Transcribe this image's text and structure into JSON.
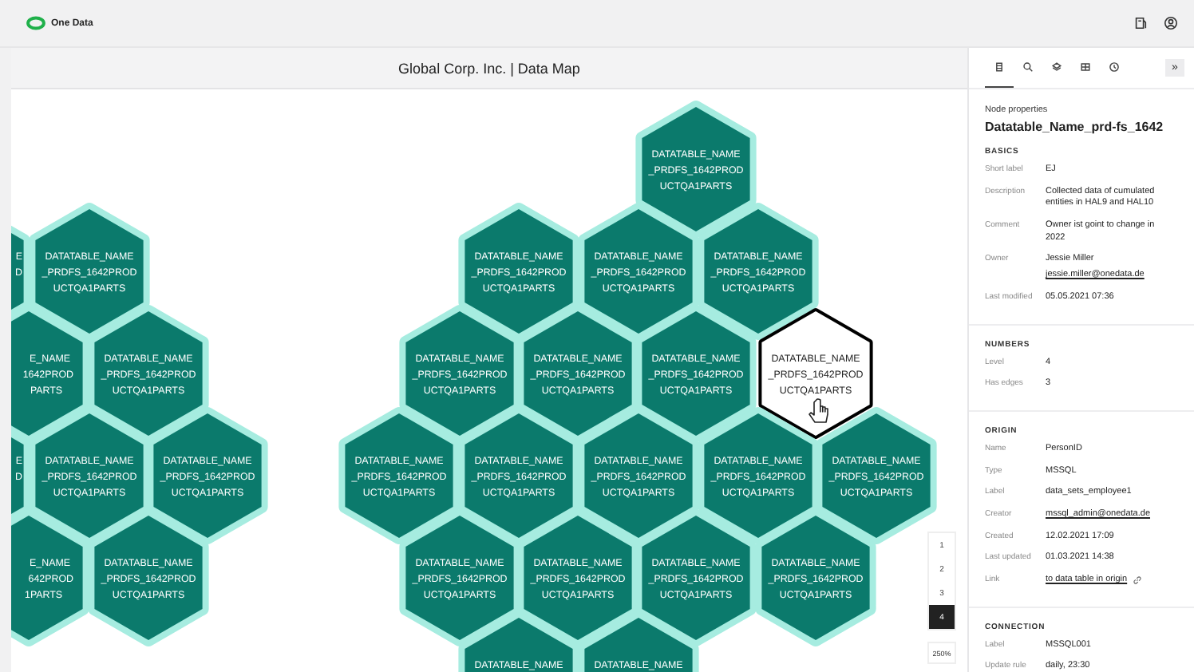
{
  "app": {
    "brand": "One Data"
  },
  "map": {
    "title": "Global Corp. Inc. | Data Map",
    "nodes": [
      {
        "lines": [
          "DATATABLE_NAME",
          "_PRDFS_1642PROD",
          "UCTQA1PARTS"
        ],
        "selected": false
      },
      {
        "lines": [
          "DATATABLE_NAME",
          "_PRDFS_1642PROD",
          "UCTQA1PARTS"
        ],
        "selected": false
      },
      {
        "lines": [
          "DATATABLE_NAME",
          "_PRDFS_1642PROD",
          "UCTQA1PARTS"
        ],
        "selected": false
      },
      {
        "lines": [
          "DATATABLE_NAME",
          "_PRDFS_1642PROD",
          "UCTQA1PARTS"
        ],
        "selected": false
      },
      {
        "lines": [
          "DATATABLE_NAME",
          "_PRDFS_1642PROD",
          "UCTQA1PARTS"
        ],
        "selected": false
      },
      {
        "lines": [
          "DATATABLE_NAME",
          "_PRDFS_1642PROD",
          "UCTQA1PARTS"
        ],
        "selected": false
      },
      {
        "lines": [
          "DATATABLE_NAME",
          "_PRDFS_1642PROD",
          "UCTQA1PARTS"
        ],
        "selected": false
      },
      {
        "lines": [
          "DATATABLE_NAME",
          "_PRDFS_1642PROD",
          "UCTQA1PARTS"
        ],
        "selected": true
      },
      {
        "lines": [
          "DATATABLE_NAME",
          "_PRDFS_1642PROD",
          "UCTQA1PARTS"
        ],
        "selected": false
      },
      {
        "lines": [
          "DATATABLE_NAME",
          "_PRDFS_1642PROD",
          "UCTQA1PARTS"
        ],
        "selected": false
      },
      {
        "lines": [
          "DATATABLE_NAME",
          "_PRDFS_1642PROD",
          "UCTQA1PARTS"
        ],
        "selected": false
      },
      {
        "lines": [
          "DATATABLE_NAME",
          "_PRDFS_1642PROD",
          "UCTQA1PARTS"
        ],
        "selected": false
      },
      {
        "lines": [
          "DATATABLE_NAME",
          "_PRDFS_1642PROD",
          "UCTQA1PARTS"
        ],
        "selected": false
      },
      {
        "lines": [
          "DATATABLE_NAME",
          "_PRDFS_1642PROD",
          "UCTQA1PARTS"
        ],
        "selected": false
      },
      {
        "lines": [
          "DATATABLE_NAME",
          "_PRDFS_1642PROD",
          "UCTQA1PARTS"
        ],
        "selected": false
      },
      {
        "lines": [
          "DATATABLE_NAME",
          "_PRDFS_1642PROD",
          "UCTQA1PARTS"
        ],
        "selected": false
      },
      {
        "lines": [
          "DATATABLE_NAME",
          "_PRDFS_1642PROD",
          "UCTQA1PARTS"
        ],
        "selected": false
      },
      {
        "lines": [
          "DATATABLE_NAME"
        ],
        "selected": false
      },
      {
        "lines": [
          "DATATABLE_NAME"
        ],
        "selected": false
      },
      {
        "lines": [
          "E",
          "D"
        ],
        "selected": false
      },
      {
        "lines": [
          "DATATABLE_NAME",
          "_PRDFS_1642PROD",
          "UCTQA1PARTS"
        ],
        "selected": false
      },
      {
        "lines": [
          "E_NAME",
          "1642PROD",
          "PARTS"
        ],
        "selected": false
      },
      {
        "lines": [
          "DATATABLE_NAME",
          "_PRDFS_1642PROD",
          "UCTQA1PARTS"
        ],
        "selected": false
      },
      {
        "lines": [
          "E",
          "D"
        ],
        "selected": false
      },
      {
        "lines": [
          "DATATABLE_NAME",
          "_PRDFS_1642PROD",
          "UCTQA1PARTS"
        ],
        "selected": false
      },
      {
        "lines": [
          "DATATABLE_NAME",
          "_PRDFS_1642PROD",
          "UCTQA1PARTS"
        ],
        "selected": false
      },
      {
        "lines": [
          "E_NAME",
          "642PROD",
          "1PARTS"
        ],
        "selected": false
      },
      {
        "lines": [
          "DATATABLE_NAME",
          "_PRDFS_1642PROD",
          "UCTQA1PARTS"
        ],
        "selected": false
      }
    ],
    "levels": [
      {
        "label": "1",
        "selected": false
      },
      {
        "label": "2",
        "selected": false
      },
      {
        "label": "3",
        "selected": false
      },
      {
        "label": "4",
        "selected": true
      }
    ],
    "zoom": "250%"
  },
  "panel": {
    "tabs": [
      {
        "kind": "database",
        "selected": true
      },
      {
        "kind": "search",
        "selected": false
      },
      {
        "kind": "layers",
        "selected": false
      },
      {
        "kind": "table",
        "selected": false
      },
      {
        "kind": "clock",
        "selected": false
      }
    ],
    "collapse": "»",
    "caption": "Node properties",
    "name": "Datatable_Name_prd-fs_1642",
    "sections": [
      {
        "title": "BASICS",
        "fields": [
          {
            "label": "Short label",
            "values": [
              {
                "text": "EJ",
                "kind": "text"
              }
            ]
          },
          {
            "label": "Description",
            "values": [
              {
                "text": "Collected data of cumulated entities in HAL9 and HAL10",
                "kind": "text"
              }
            ]
          },
          {
            "label": "Comment",
            "values": [
              {
                "text": "Owner ist goint to change in 2022",
                "kind": "text"
              }
            ]
          },
          {
            "label": "Owner",
            "values": [
              {
                "text": "Jessie Miller",
                "kind": "text"
              },
              {
                "text": "jessie.miller@onedata.de",
                "kind": "link"
              }
            ]
          },
          {
            "label": "Last modified",
            "values": [
              {
                "text": "05.05.2021 07:36",
                "kind": "text"
              }
            ]
          }
        ]
      },
      {
        "title": "NUMBERS",
        "fields": [
          {
            "label": "Level",
            "values": [
              {
                "text": "4",
                "kind": "text"
              }
            ]
          },
          {
            "label": "Has edges",
            "values": [
              {
                "text": "3",
                "kind": "text"
              }
            ]
          }
        ]
      },
      {
        "title": "ORIGIN",
        "fields": [
          {
            "label": "Name",
            "values": [
              {
                "text": "PersonID",
                "kind": "text"
              }
            ]
          },
          {
            "label": "Type",
            "values": [
              {
                "text": "MSSQL",
                "kind": "text"
              }
            ]
          },
          {
            "label": "Label",
            "values": [
              {
                "text": "data_sets_employee1",
                "kind": "text"
              }
            ]
          },
          {
            "label": "Creator",
            "values": [
              {
                "text": "mssql_admin@onedata.de",
                "kind": "link"
              }
            ]
          },
          {
            "label": "Created",
            "values": [
              {
                "text": "12.02.2021 17:09",
                "kind": "text"
              }
            ]
          },
          {
            "label": "Last updated",
            "values": [
              {
                "text": "01.03.2021 14:38",
                "kind": "text"
              }
            ]
          },
          {
            "label": "Link",
            "values": [
              {
                "text": "to data table in origin",
                "kind": "external"
              }
            ]
          }
        ]
      },
      {
        "title": "CONNECTION",
        "fields": [
          {
            "label": "Label",
            "values": [
              {
                "text": "MSSQL001",
                "kind": "text"
              }
            ]
          },
          {
            "label": "Update rule",
            "values": [
              {
                "text": "daily, 23:30",
                "kind": "text"
              }
            ]
          }
        ]
      }
    ]
  }
}
